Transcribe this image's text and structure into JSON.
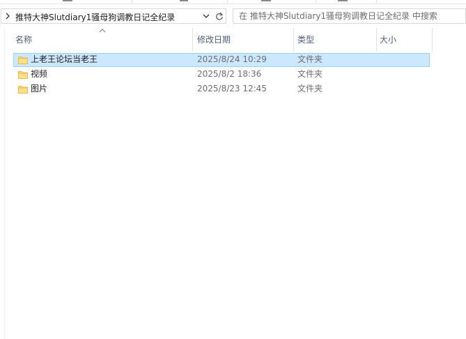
{
  "address_bar": {
    "path": "推特大神Slutdiary1骚母狗调教日记全纪录"
  },
  "search": {
    "placeholder": "在 推特大神Slutdiary1骚母狗调教日记全纪录 中搜索"
  },
  "columns": {
    "name": "名称",
    "date_modified": "修改日期",
    "type": "类型",
    "size": "大小"
  },
  "files": [
    {
      "name": "上老王论坛当老王",
      "date": "2025/8/24 10:29",
      "type": "文件夹",
      "selected": true
    },
    {
      "name": "视频",
      "date": "2025/8/2 18:36",
      "type": "文件夹",
      "selected": false
    },
    {
      "name": "图片",
      "date": "2025/8/23 12:45",
      "type": "文件夹",
      "selected": false
    }
  ],
  "colors": {
    "selection_bg": "#cce8ff",
    "selection_border": "#99d1ff",
    "folder_yellow": "#ffd766",
    "header_text": "#4c607a"
  },
  "icons": {
    "folder": "folder-icon",
    "refresh": "refresh-icon",
    "dropdown": "chevron-down-icon",
    "sort": "sort-up-icon"
  }
}
